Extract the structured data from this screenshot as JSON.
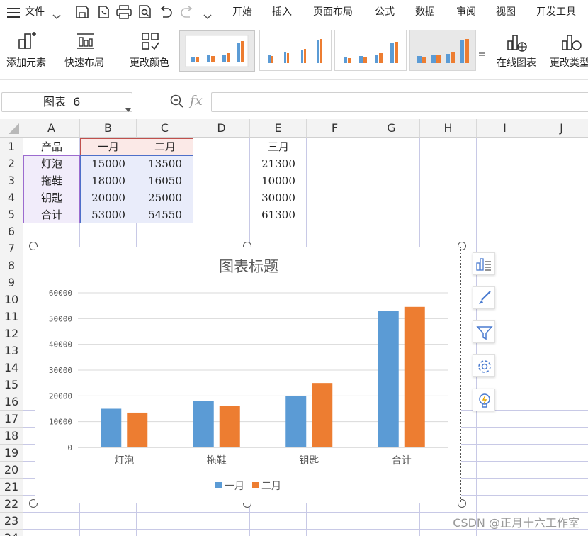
{
  "menu": {
    "file": "文件",
    "tabs": [
      "开始",
      "插入",
      "页面布局",
      "公式",
      "数据",
      "审阅",
      "视图",
      "开发工具"
    ]
  },
  "ribbon": {
    "add_element": "添加元素",
    "quick_layout": "快速布局",
    "change_color": "更改颜色",
    "online_chart": "在线图表",
    "change_type": "更改类型"
  },
  "formula_bar": {
    "name_box": "图表  6",
    "fx": "fx",
    "formula": ""
  },
  "sheet": {
    "columns": [
      "A",
      "B",
      "C",
      "D",
      "E",
      "F",
      "G",
      "H",
      "I",
      "J"
    ],
    "rows": [
      "1",
      "2",
      "3",
      "4",
      "5",
      "6",
      "7",
      "8",
      "9",
      "10",
      "11",
      "12",
      "13",
      "14",
      "15",
      "16",
      "17",
      "18",
      "19",
      "20",
      "21",
      "22",
      "23",
      "24"
    ],
    "cells": {
      "A1": "产品",
      "B1": "一月",
      "C1": "二月",
      "E1": "三月",
      "A2": "灯泡",
      "B2": "15000",
      "C2": "13500",
      "E2": "21300",
      "A3": "拖鞋",
      "B3": "18000",
      "C3": "16050",
      "E3": "10000",
      "A4": "钥匙",
      "B4": "20000",
      "C4": "25000",
      "E4": "30000",
      "A5": "合计",
      "B5": "53000",
      "C5": "54550",
      "E5": "61300"
    }
  },
  "chart_data": {
    "type": "bar",
    "title": "图表标题",
    "categories": [
      "灯泡",
      "拖鞋",
      "钥匙",
      "合计"
    ],
    "series": [
      {
        "name": "一月",
        "values": [
          15000,
          18000,
          20000,
          53000
        ],
        "color": "#5b9bd5"
      },
      {
        "name": "二月",
        "values": [
          13500,
          16050,
          25000,
          54550
        ],
        "color": "#ed7d31"
      }
    ],
    "ylim": [
      0,
      60000
    ],
    "yticks": [
      "0",
      "10000",
      "20000",
      "30000",
      "40000",
      "50000",
      "60000"
    ],
    "grid": true,
    "legend": "bottom"
  },
  "side_buttons": [
    "chart-elements-icon",
    "brush-icon",
    "filter-icon",
    "settings-icon",
    "lightbulb-icon"
  ],
  "watermark": "CSDN @正月十六工作室"
}
